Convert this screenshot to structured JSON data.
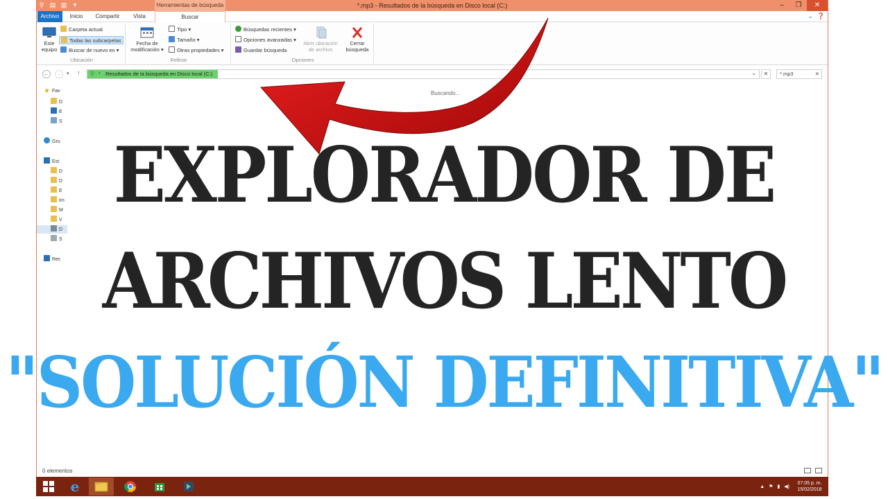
{
  "window": {
    "title": "*.mp3 - Resultados de la búsqueda en Disco local (C:)",
    "context_tab_header": "Herramientas de búsqueda",
    "controls": [
      "–",
      "❐",
      "✕"
    ]
  },
  "tabs": {
    "archivo": "Archivo",
    "inicio": "Inicio",
    "compartir": "Compartir",
    "vista": "Vista",
    "buscar": "Buscar"
  },
  "ribbon": {
    "ubicacion": {
      "label": "Ubicación",
      "este_equipo_1": "Este",
      "este_equipo_2": "equipo",
      "carpeta_actual": "Carpeta actual",
      "todas_subcarpetas": "Todas las subcarpetas",
      "buscar_de_nuevo": "Buscar de nuevo en ▾"
    },
    "refinar": {
      "label": "Refinar",
      "fecha_1": "Fecha de",
      "fecha_2": "modificación ▾",
      "tipo": "Tipo ▾",
      "tamano": "Tamaño ▾",
      "otras": "Otras propiedades ▾"
    },
    "opciones": {
      "label": "Opciones",
      "recientes": "Búsquedas recientes ▾",
      "avanzadas": "Opciones avanzadas ▾",
      "guardar": "Guardar búsqueda",
      "abrir_1": "Abrir ubicación",
      "abrir_2": "de archivo",
      "cerrar_1": "Cerrar",
      "cerrar_2": "búsqueda"
    }
  },
  "address": {
    "path": "Resultados de la búsqueda en Disco local (C:)",
    "search_value": "*.mp3"
  },
  "nav": {
    "favoritos": "Fav",
    "f1": "D",
    "f2": "E",
    "f3": "S",
    "grupo": "Gru",
    "equipo": "Est",
    "e1": "D",
    "e2": "D",
    "e3": "E",
    "e4": "Im",
    "e5": "M",
    "e6": "V",
    "e7": "D",
    "e8": "S",
    "red": "Rec"
  },
  "content": {
    "searching": "Buscando...",
    "status": "0 elementos"
  },
  "taskbar": {
    "time": "07:05 p. m.",
    "date": "15/02/2018"
  },
  "overlay": {
    "line1": "EXPLORADOR DE",
    "line2": "ARCHIVOS LENTO",
    "line3": "\"SOLUCIÓN DEFINITIVA\""
  },
  "colors": {
    "title_bar": "#f0906a",
    "accent_blue": "#1a72c4",
    "taskbar": "#7a2410",
    "headline_dark": "#242424",
    "headline_blue": "#3aa9f0",
    "arrow_red": "#d01010"
  }
}
